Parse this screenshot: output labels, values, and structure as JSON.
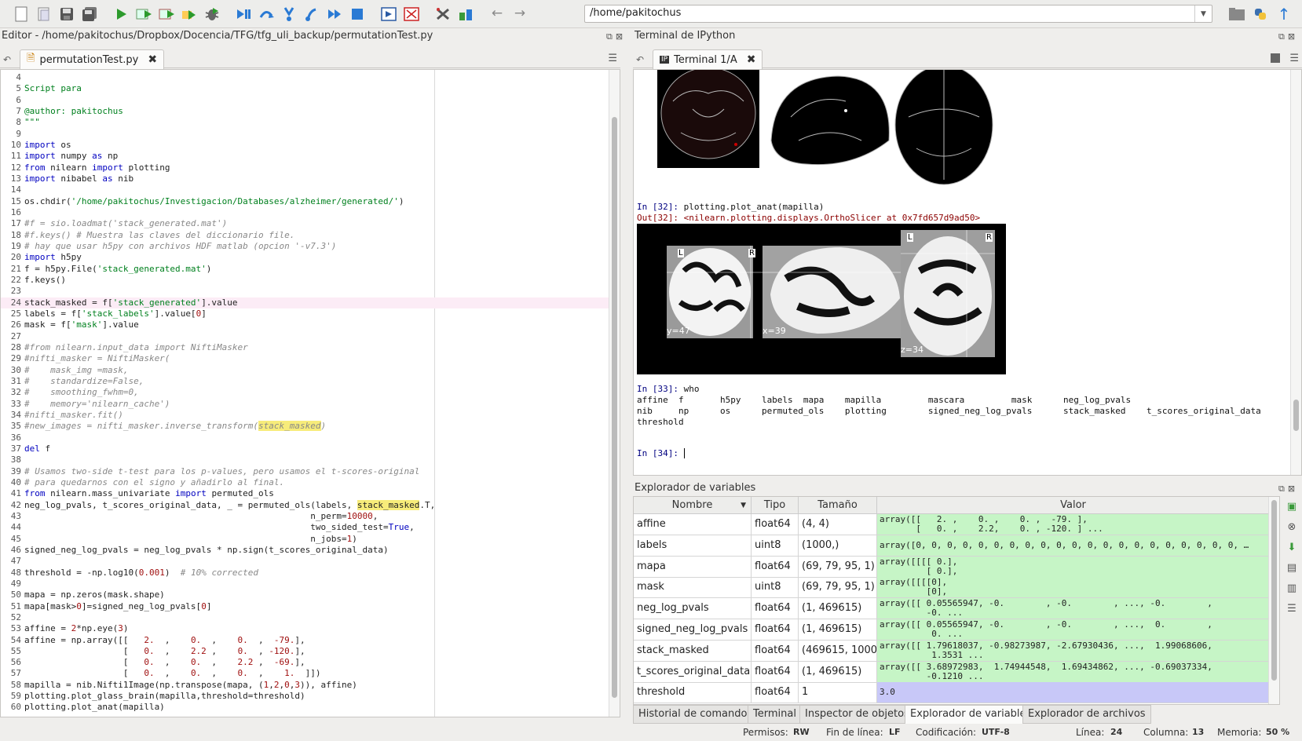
{
  "toolbar": {
    "icons": [
      "new-file-icon",
      "open-file-icon",
      "save-icon",
      "save-all-icon",
      "run-icon",
      "run-cell-icon",
      "run-cell-advance-icon",
      "run-selection-icon",
      "debug-icon",
      "debug-step-icon",
      "step-over-icon",
      "step-into-icon",
      "step-out-icon",
      "continue-icon",
      "stop-debug-icon",
      "maximize-pane-icon",
      "fullscreen-icon",
      "preferences-icon",
      "pythonpath-icon",
      "back-icon",
      "forward-icon"
    ],
    "path": "/home/pakitochus"
  },
  "editor": {
    "title": "Editor - /home/pakitochus/Dropbox/Docencia/TFG/tfg_uli_backup/permutationTest.py",
    "tab_label": "permutationTest.py",
    "current_line": 24,
    "lines": [
      {
        "n": "4",
        "html": ""
      },
      {
        "n": "5",
        "html": "<span class='doc'>Script para</span>"
      },
      {
        "n": "6",
        "html": ""
      },
      {
        "n": "7",
        "html": "<span class='doc'>@author: pakitochus</span>"
      },
      {
        "n": "8",
        "html": "<span class='doc'>\"\"\"</span>"
      },
      {
        "n": "9",
        "html": ""
      },
      {
        "n": "10",
        "html": "<span class='kw'>import</span> os"
      },
      {
        "n": "11",
        "html": "<span class='kw'>import</span> numpy <span class='kw'>as</span> np"
      },
      {
        "n": "12",
        "html": "<span class='kw'>from</span> nilearn <span class='kw'>import</span> plotting"
      },
      {
        "n": "13",
        "html": "<span class='kw'>import</span> nibabel <span class='kw'>as</span> nib"
      },
      {
        "n": "14",
        "html": ""
      },
      {
        "n": "15",
        "html": "os.chdir(<span class='str'>'/home/pakitochus/Investigacion/Databases/alzheimer/generated/'</span>)"
      },
      {
        "n": "16",
        "html": ""
      },
      {
        "n": "17",
        "html": "<span class='cm'>#f = sio.loadmat('stack_generated.mat')</span>"
      },
      {
        "n": "18",
        "html": "<span class='cm'>#f.keys() # Muestra las claves del diccionario file.</span>"
      },
      {
        "n": "19",
        "html": "<span class='cm'># hay que usar h5py con archivos HDF matlab (opcion '-v7.3')</span>"
      },
      {
        "n": "20",
        "html": "<span class='kw'>import</span> h5py"
      },
      {
        "n": "21",
        "html": "f = h5py.File(<span class='str'>'stack_generated.mat'</span>)"
      },
      {
        "n": "22",
        "html": "f.keys()"
      },
      {
        "n": "23",
        "html": ""
      },
      {
        "n": "24",
        "html": "stack_masked = f[<span class='str'>'stack_generated'</span>].value"
      },
      {
        "n": "25",
        "html": "labels = f[<span class='str'>'stack_labels'</span>].value[<span class='num'>0</span>]"
      },
      {
        "n": "26",
        "html": "mask = f[<span class='str'>'mask'</span>].value"
      },
      {
        "n": "27",
        "html": ""
      },
      {
        "n": "28",
        "html": "<span class='cm'>#from nilearn.input_data import NiftiMasker</span>"
      },
      {
        "n": "29",
        "html": "<span class='cm'>#nifti_masker = NiftiMasker(</span>"
      },
      {
        "n": "30",
        "html": "<span class='cm'>#    mask_img =mask,</span>"
      },
      {
        "n": "31",
        "html": "<span class='cm'>#    standardize=False,</span>"
      },
      {
        "n": "32",
        "html": "<span class='cm'>#    smoothing_fwhm=0,</span>"
      },
      {
        "n": "33",
        "html": "<span class='cm'>#    memory='nilearn_cache')</span>"
      },
      {
        "n": "34",
        "html": "<span class='cm'>#nifti_masker.fit()</span>"
      },
      {
        "n": "35",
        "html": "<span class='cm'>#new_images = nifti_masker.inverse_transform(<span class='hl'>stack_masked</span>)</span>"
      },
      {
        "n": "36",
        "html": ""
      },
      {
        "n": "37",
        "html": "<span class='kw'>del</span> f"
      },
      {
        "n": "38",
        "html": ""
      },
      {
        "n": "39",
        "html": "<span class='cm'># Usamos two-side t-test para los p-values, pero usamos el t-scores-original</span>"
      },
      {
        "n": "40",
        "html": "<span class='cm'># para quedarnos con el signo y añadirlo al final.</span>"
      },
      {
        "n": "41",
        "html": "<span class='kw'>from</span> nilearn.mass_univariate <span class='kw'>import</span> permuted_ols"
      },
      {
        "n": "42",
        "html": "neg_log_pvals, t_scores_original_data, _ = permuted_ols(labels, <span class='hl'>stack_masked</span>.T,"
      },
      {
        "n": "43",
        "html": "                                                       n_perm=<span class='num'>10000</span>,"
      },
      {
        "n": "44",
        "html": "                                                       two_sided_test=<span class='kw'>True</span>,"
      },
      {
        "n": "45",
        "html": "                                                       n_jobs=<span class='num'>1</span>)"
      },
      {
        "n": "46",
        "html": "signed_neg_log_pvals = neg_log_pvals * np.sign(t_scores_original_data)"
      },
      {
        "n": "47",
        "html": ""
      },
      {
        "n": "48",
        "html": "threshold = -np.log10(<span class='num'>0.001</span>)  <span class='cm'># 10% corrected</span>"
      },
      {
        "n": "49",
        "html": ""
      },
      {
        "n": "50",
        "html": "mapa = np.zeros(mask.shape)"
      },
      {
        "n": "51",
        "html": "mapa[mask&gt;<span class='num'>0</span>]=signed_neg_log_pvals[<span class='num'>0</span>]"
      },
      {
        "n": "52",
        "html": ""
      },
      {
        "n": "53",
        "html": "affine = <span class='num'>2</span>*np.eye(<span class='num'>3</span>)"
      },
      {
        "n": "54",
        "html": "affine = np.array([[   <span class='num'>2.</span>  ,    <span class='num'>0.</span>  ,    <span class='num'>0.</span>  ,  <span class='num'>-79.</span>],"
      },
      {
        "n": "55",
        "html": "                   [   <span class='num'>0.</span>  ,    <span class='num'>2.2</span> ,    <span class='num'>0.</span>  , <span class='num'>-120.</span>],"
      },
      {
        "n": "56",
        "html": "                   [   <span class='num'>0.</span>  ,    <span class='num'>0.</span>  ,    <span class='num'>2.2</span> ,  <span class='num'>-69.</span>],"
      },
      {
        "n": "57",
        "html": "                   [   <span class='num'>0.</span>  ,    <span class='num'>0.</span>  ,    <span class='num'>0.</span>  ,    <span class='num'>1.</span>  ]])"
      },
      {
        "n": "58",
        "html": "mapilla = nib.Nifti1Image(np.transpose(mapa, (<span class='num'>1</span>,<span class='num'>2</span>,<span class='num'>0</span>,<span class='num'>3</span>)), affine)"
      },
      {
        "n": "59",
        "html": "plotting.plot_glass_brain(mapilla,threshold=threshold)"
      },
      {
        "n": "60",
        "html": "plotting.plot_anat(mapilla)"
      }
    ]
  },
  "terminal": {
    "title": "Terminal de IPython",
    "tab_label": "Terminal 1/A",
    "fig1_label": "R",
    "in32": "In [32]: ",
    "in32_code": "plotting.plot_anat(mapilla)",
    "out32": "Out[32]: <nilearn.plotting.displays.OrthoSlicer at 0x7fd657d9ad50>",
    "fig2_labels": {
      "L1": "L",
      "R1": "R",
      "L2": "L",
      "R2": "R",
      "y": "y=47",
      "x": "x=39",
      "z": "z=34"
    },
    "in33": "In [33]: ",
    "in33_code": "who",
    "who_lines": [
      "affine  f       h5py    labels  mapa    mapilla         mascara         mask      neg_log_pvals",
      "nib     np      os      permuted_ols    plotting        signed_neg_log_pvals      stack_masked    t_scores_original_data",
      "threshold"
    ],
    "in34": "In [34]: "
  },
  "variables": {
    "title": "Explorador de variables",
    "headers": {
      "name": "Nombre",
      "type": "Tipo",
      "size": "Tamaño",
      "value": "Valor"
    },
    "rows": [
      {
        "name": "affine",
        "type": "float64",
        "size": "(4, 4)",
        "value": "array([[   2. ,    0. ,    0. ,  -79. ],\n       [   0. ,    2.2,    0. , -120. ] ..."
      },
      {
        "name": "labels",
        "type": "uint8",
        "size": "(1000,)",
        "value": "array([0, 0, 0, 0, 0, 0, 0, 0, 0, 0, 0, 0, 0, 0, 0, 0, 0, 0, 0, 0, 0, …"
      },
      {
        "name": "mapa",
        "type": "float64",
        "size": "(69, 79, 95, 1)",
        "value": "array([[[[ 0.],\n         [ 0.],"
      },
      {
        "name": "mask",
        "type": "uint8",
        "size": "(69, 79, 95, 1)",
        "value": "array([[[[0],\n         [0],"
      },
      {
        "name": "neg_log_pvals",
        "type": "float64",
        "size": "(1, 469615)",
        "value": "array([[ 0.05565947, -0.        , -0.        , ..., -0.        ,\n         -0. ..."
      },
      {
        "name": "signed_neg_log_pvals",
        "type": "float64",
        "size": "(1, 469615)",
        "value": "array([[ 0.05565947, -0.        , -0.        , ...,  0.        ,\n          0. ..."
      },
      {
        "name": "stack_masked",
        "type": "float64",
        "size": "(469615, 1000)",
        "value": "array([[ 1.79618037, -0.98273987, -2.67930436, ...,  1.99068606,\n          1.3531 ..."
      },
      {
        "name": "t_scores_original_data",
        "type": "float64",
        "size": "(1, 469615)",
        "value": "array([[ 3.68972983,  1.74944548,  1.69434862, ..., -0.69037334,\n         -0.1210 ..."
      },
      {
        "name": "threshold",
        "type": "float64",
        "size": "1",
        "value": "3.0"
      }
    ],
    "colors": {
      "array": "#c6f5c6",
      "scalar": "#c8c8f8"
    }
  },
  "bottom_tabs": [
    "Historial de comandos",
    "Terminal",
    "Inspector de objetos",
    "Explorador de variables",
    "Explorador de archivos"
  ],
  "active_bottom_tab": 3,
  "status": {
    "perm_label": "Permisos:",
    "perm": "RW",
    "eol_label": "Fin de línea:",
    "eol": "LF",
    "enc_label": "Codificación:",
    "enc": "UTF-8",
    "line_label": "Línea:",
    "line": "24",
    "col_label": "Columna:",
    "col": "13",
    "mem_label": "Memoria:",
    "mem": "50 %"
  }
}
